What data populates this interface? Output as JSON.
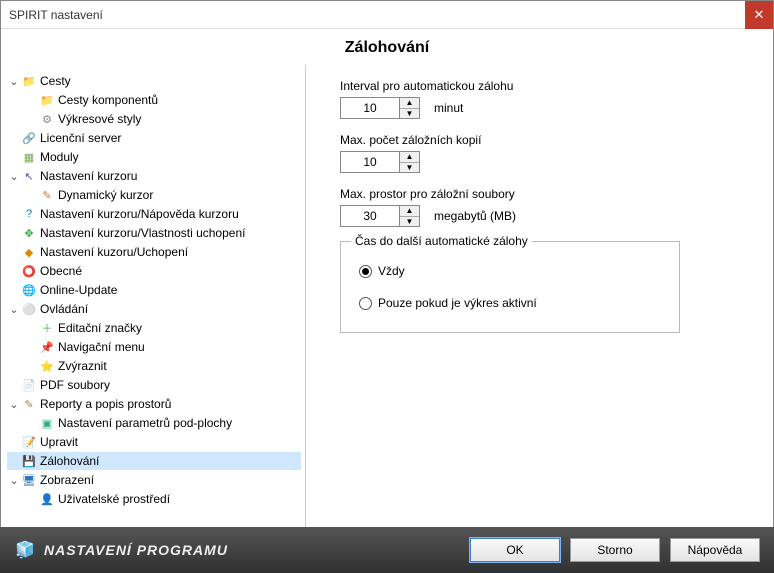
{
  "window": {
    "title": "SPIRIT nastavení"
  },
  "page_title": "Zálohování",
  "tree": [
    {
      "label": "Cesty",
      "indent": 0,
      "expander": "⌄",
      "icon": "📁",
      "iconClass": "i-folder",
      "name": "tree-paths"
    },
    {
      "label": "Cesty komponentů",
      "indent": 1,
      "expander": "",
      "icon": "📁",
      "iconClass": "i-folder",
      "name": "tree-component-paths"
    },
    {
      "label": "Výkresové styly",
      "indent": 1,
      "expander": "",
      "icon": "⚙",
      "iconClass": "i-gear",
      "name": "tree-drawing-styles"
    },
    {
      "label": "Licenční server",
      "indent": 0,
      "expander": "",
      "icon": "🔗",
      "iconClass": "i-link",
      "name": "tree-license-server"
    },
    {
      "label": "Moduly",
      "indent": 0,
      "expander": "",
      "icon": "▦",
      "iconClass": "i-mod",
      "name": "tree-modules"
    },
    {
      "label": "Nastavení kurzoru",
      "indent": 0,
      "expander": "⌄",
      "icon": "↖",
      "iconClass": "i-cursor",
      "name": "tree-cursor-settings"
    },
    {
      "label": "Dynamický kurzor",
      "indent": 1,
      "expander": "",
      "icon": "✎",
      "iconClass": "i-pen",
      "name": "tree-dynamic-cursor"
    },
    {
      "label": "Nastavení kurzoru/Nápověda kurzoru",
      "indent": 0,
      "expander": "",
      "icon": "?",
      "iconClass": "i-help",
      "name": "tree-cursor-help"
    },
    {
      "label": "Nastavení kurzoru/Vlastnosti uchopení",
      "indent": 0,
      "expander": "",
      "icon": "✥",
      "iconClass": "i-snap",
      "name": "tree-snap-props"
    },
    {
      "label": "Nastavení kuzoru/Uchopení",
      "indent": 0,
      "expander": "",
      "icon": "◆",
      "iconClass": "i-warn",
      "name": "tree-snap"
    },
    {
      "label": "Obecné",
      "indent": 0,
      "expander": "",
      "icon": "⭕",
      "iconClass": "i-warn",
      "name": "tree-general"
    },
    {
      "label": "Online-Update",
      "indent": 0,
      "expander": "",
      "icon": "🌐",
      "iconClass": "i-globe",
      "name": "tree-online-update"
    },
    {
      "label": "Ovládání",
      "indent": 0,
      "expander": "⌄",
      "icon": "⚪",
      "iconClass": "i-ov",
      "name": "tree-controls"
    },
    {
      "label": "Editační značky",
      "indent": 1,
      "expander": "",
      "icon": "＋",
      "iconClass": "i-plus",
      "name": "tree-edit-marks"
    },
    {
      "label": "Navigační menu",
      "indent": 1,
      "expander": "",
      "icon": "📌",
      "iconClass": "i-pin",
      "name": "tree-nav-menu"
    },
    {
      "label": "Zvýraznit",
      "indent": 1,
      "expander": "",
      "icon": "⭐",
      "iconClass": "i-hl",
      "name": "tree-highlight"
    },
    {
      "label": "PDF soubory",
      "indent": 0,
      "expander": "",
      "icon": "📄",
      "iconClass": "i-pdf",
      "name": "tree-pdf"
    },
    {
      "label": "Reporty a popis prostorů",
      "indent": 0,
      "expander": "⌄",
      "icon": "✎",
      "iconClass": "i-rep",
      "name": "tree-reports"
    },
    {
      "label": "Nastavení parametrů pod-plochy",
      "indent": 1,
      "expander": "",
      "icon": "▣",
      "iconClass": "i-sub",
      "name": "tree-subarea-params"
    },
    {
      "label": "Upravit",
      "indent": 0,
      "expander": "",
      "icon": "📝",
      "iconClass": "i-edit",
      "name": "tree-edit"
    },
    {
      "label": "Zálohování",
      "indent": 0,
      "expander": "",
      "icon": "💾",
      "iconClass": "i-bak",
      "name": "tree-backup",
      "selected": true
    },
    {
      "label": "Zobrazení",
      "indent": 0,
      "expander": "⌄",
      "icon": "🖥",
      "iconClass": "i-disp",
      "name": "tree-display"
    },
    {
      "label": "Uživatelské prostředí",
      "indent": 1,
      "expander": "",
      "icon": "👤",
      "iconClass": "i-user",
      "name": "tree-user-env"
    }
  ],
  "fields": {
    "interval": {
      "label": "Interval pro automatickou zálohu",
      "value": "10",
      "unit": "minut"
    },
    "maxCopies": {
      "label": "Max. počet záložních kopií",
      "value": "10",
      "unit": ""
    },
    "maxSpace": {
      "label": "Max. prostor pro záložní soubory",
      "value": "30",
      "unit": "megabytů (MB)"
    }
  },
  "timeGroup": {
    "legend": "Čas do další automatické zálohy",
    "opt1": "Vždy",
    "opt2": "Pouze pokud je výkres aktivní",
    "selected": "opt1"
  },
  "footer": {
    "title": "NASTAVENÍ PROGRAMU",
    "ok": "OK",
    "cancel": "Storno",
    "help": "Nápověda"
  }
}
